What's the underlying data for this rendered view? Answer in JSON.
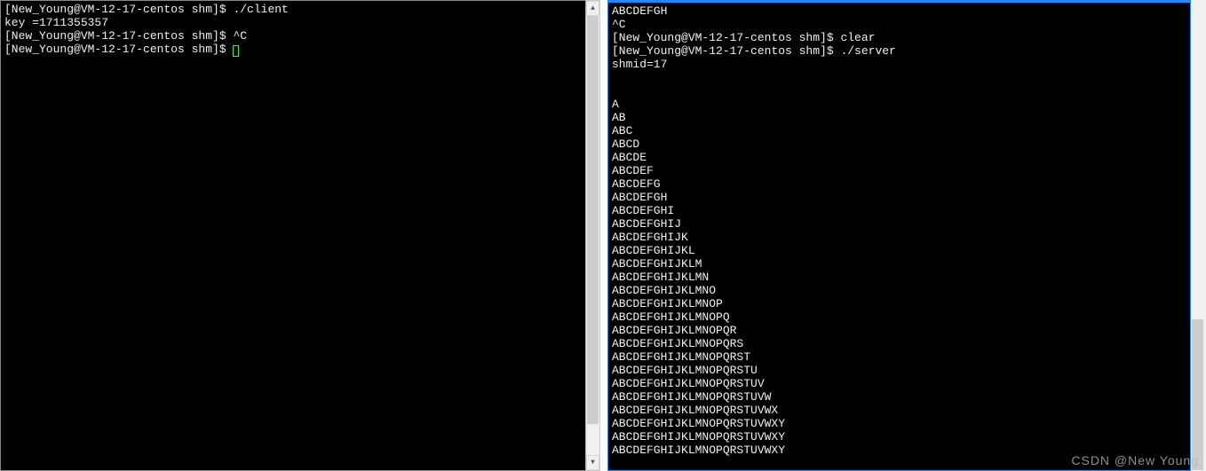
{
  "left": {
    "lines": [
      "[New_Young@VM-12-17-centos shm]$ ./client",
      "key =1711355357",
      "[New_Young@VM-12-17-centos shm]$ ^C",
      "[New_Young@VM-12-17-centos shm]$ "
    ],
    "cursor": true
  },
  "right": {
    "lines": [
      "ABCDEFGH",
      "^C",
      "[New_Young@VM-12-17-centos shm]$ clear",
      "[New_Young@VM-12-17-centos shm]$ ./server",
      "shmid=17",
      "",
      "",
      "A",
      "AB",
      "ABC",
      "ABCD",
      "ABCDE",
      "ABCDEF",
      "ABCDEFG",
      "ABCDEFGH",
      "ABCDEFGHI",
      "ABCDEFGHIJ",
      "ABCDEFGHIJK",
      "ABCDEFGHIJKL",
      "ABCDEFGHIJKLM",
      "ABCDEFGHIJKLMN",
      "ABCDEFGHIJKLMNO",
      "ABCDEFGHIJKLMNOP",
      "ABCDEFGHIJKLMNOPQ",
      "ABCDEFGHIJKLMNOPQR",
      "ABCDEFGHIJKLMNOPQRS",
      "ABCDEFGHIJKLMNOPQRST",
      "ABCDEFGHIJKLMNOPQRSTU",
      "ABCDEFGHIJKLMNOPQRSTUV",
      "ABCDEFGHIJKLMNOPQRSTUVW",
      "ABCDEFGHIJKLMNOPQRSTUVWX",
      "ABCDEFGHIJKLMNOPQRSTUVWXY",
      "ABCDEFGHIJKLMNOPQRSTUVWXY",
      "ABCDEFGHIJKLMNOPQRSTUVWXY"
    ]
  },
  "watermark": "CSDN @New  Young",
  "arrows": {
    "up": "▲",
    "down": "▼"
  }
}
